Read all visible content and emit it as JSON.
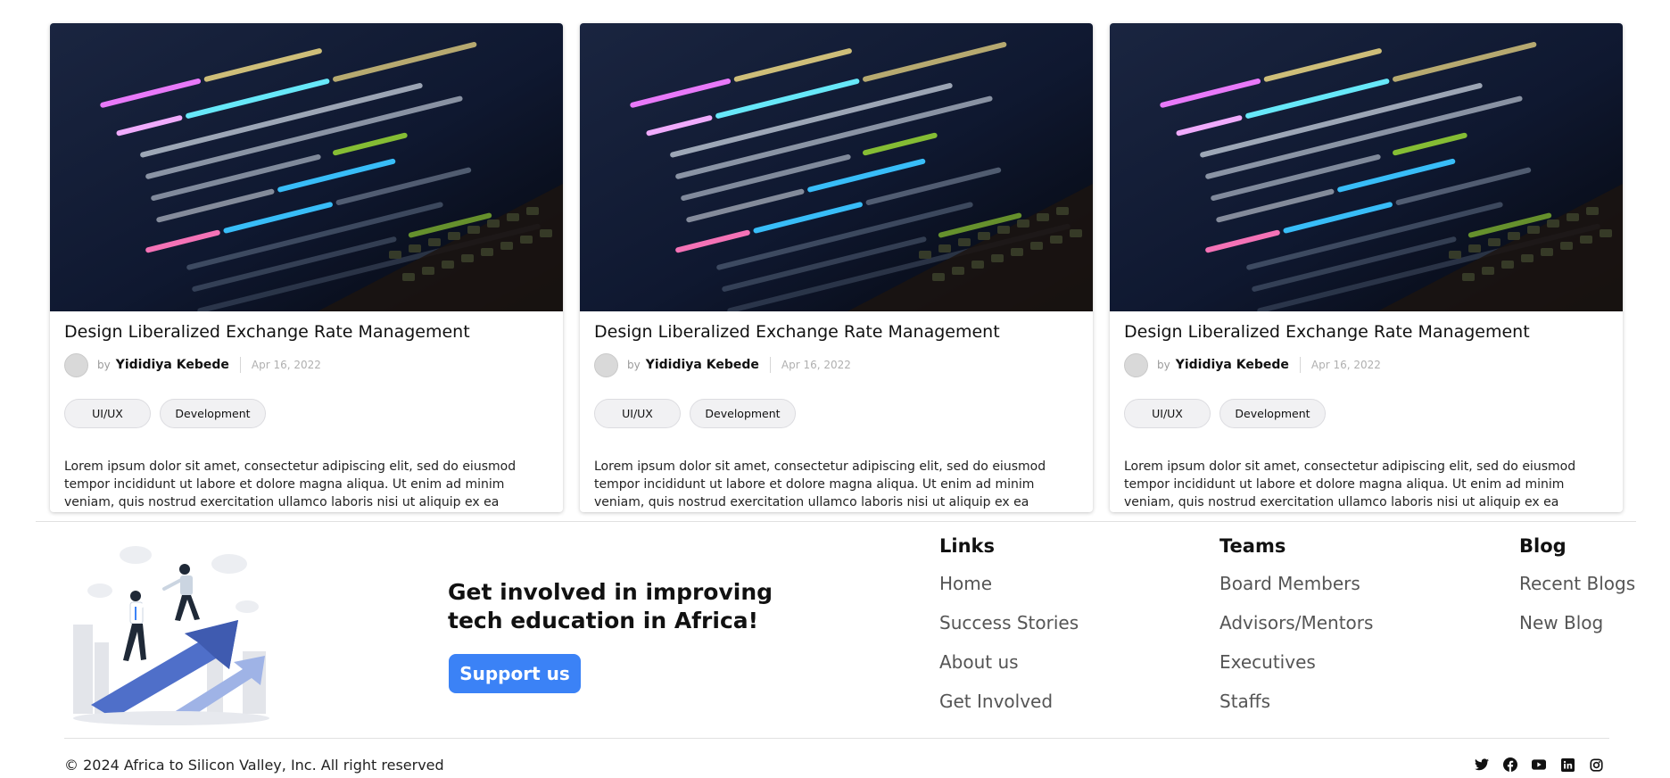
{
  "posts": [
    {
      "title": "Design Liberalized Exchange Rate Management",
      "by": "by",
      "author": "Yididiya Kebede",
      "date": "Apr 16, 2022",
      "tags": [
        "UI/UX",
        "Development"
      ],
      "excerpt": "Lorem ipsum dolor sit amet, consectetur adipiscing elit, sed do eiusmod tempor incididunt ut labore et dolore magna aliqua. Ut enim ad minim veniam, quis nostrud exercitation ullamco laboris nisi ut aliquip ex ea"
    },
    {
      "title": "Design Liberalized Exchange Rate Management",
      "by": "by",
      "author": "Yididiya Kebede",
      "date": "Apr 16, 2022",
      "tags": [
        "UI/UX",
        "Development"
      ],
      "excerpt": "Lorem ipsum dolor sit amet, consectetur adipiscing elit, sed do eiusmod tempor incididunt ut labore et dolore magna aliqua. Ut enim ad minim veniam, quis nostrud exercitation ullamco laboris nisi ut aliquip ex ea"
    },
    {
      "title": "Design Liberalized Exchange Rate Management",
      "by": "by",
      "author": "Yididiya Kebede",
      "date": "Apr 16, 2022",
      "tags": [
        "UI/UX",
        "Development"
      ],
      "excerpt": "Lorem ipsum dolor sit amet, consectetur adipiscing elit, sed do eiusmod tempor incididunt ut labore et dolore magna aliqua. Ut enim ad minim veniam, quis nostrud exercitation ullamco laboris nisi ut aliquip ex ea"
    }
  ],
  "cta": {
    "title": "Get involved in improving tech education in Africa!",
    "button": "Support us"
  },
  "footer": {
    "links": {
      "heading": "Links",
      "items": [
        "Home",
        "Success Stories",
        "About us",
        "Get Involved"
      ]
    },
    "teams": {
      "heading": "Teams",
      "items": [
        "Board Members",
        "Advisors/Mentors",
        "Executives",
        "Staffs"
      ]
    },
    "blog": {
      "heading": "Blog",
      "items": [
        "Recent Blogs",
        "New Blog"
      ]
    },
    "copyright": "© 2024 Africa to Silicon Valley, Inc. All right reserved",
    "socials": [
      "twitter-icon",
      "facebook-icon",
      "youtube-icon",
      "linkedin-icon",
      "instagram-icon"
    ]
  },
  "colors": {
    "accent": "#3b82f6",
    "tag_bg": "#f1f1f3",
    "link_text": "#555555"
  }
}
